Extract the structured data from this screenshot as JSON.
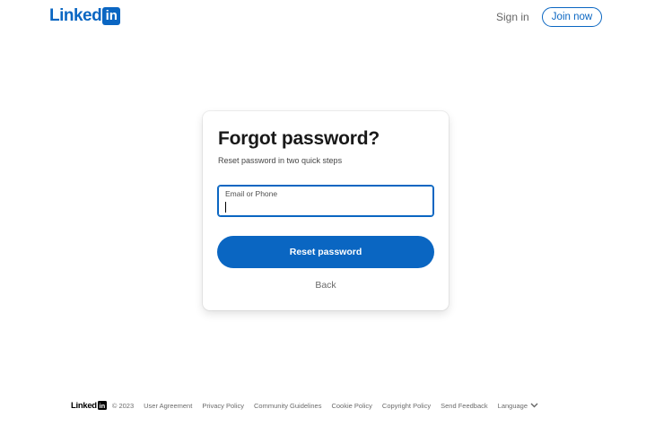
{
  "header": {
    "logo_text": "Linked",
    "logo_box": "in",
    "signin_label": "Sign in",
    "join_label": "Join now"
  },
  "card": {
    "title": "Forgot password?",
    "subtitle": "Reset password in two quick steps",
    "input_label": "Email or Phone",
    "input_value": "",
    "reset_label": "Reset password",
    "back_label": "Back"
  },
  "footer": {
    "logo_text": "Linked",
    "logo_box": "in",
    "copyright": "© 2023",
    "links": [
      "User Agreement",
      "Privacy Policy",
      "Community Guidelines",
      "Cookie Policy",
      "Copyright Policy",
      "Send Feedback"
    ],
    "language_label": "Language"
  },
  "colors": {
    "brand": "#0a66c2",
    "text": "#000000",
    "background": "#ffffff"
  },
  "icons": {
    "language_chevron": "chevron-down-icon"
  }
}
